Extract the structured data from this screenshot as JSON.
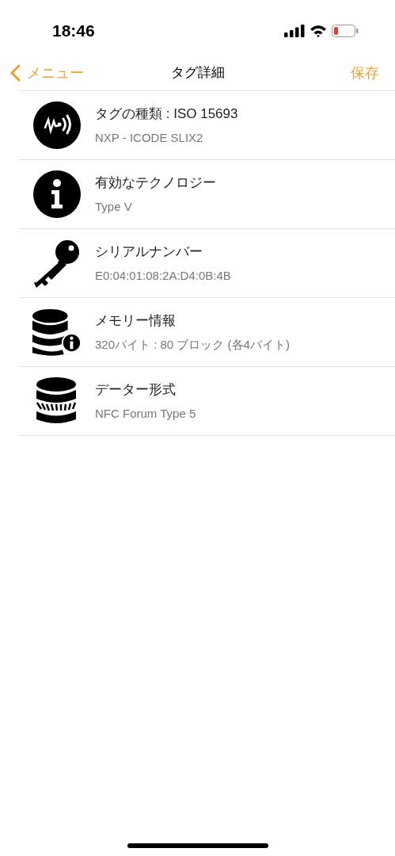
{
  "status_bar": {
    "time": "18:46"
  },
  "nav": {
    "back": "メニュー",
    "title": "タグ詳細",
    "action": "保存"
  },
  "rows": [
    {
      "kind": "nfc",
      "title": "タグの種類 : ISO 15693",
      "subtitle": "NXP - ICODE SLIX2"
    },
    {
      "kind": "info",
      "title": "有効なテクノロジー",
      "subtitle": "Type V"
    },
    {
      "kind": "key",
      "title": "シリアルナンバー",
      "subtitle": "E0:04:01:08:2A:D4:0B:4B"
    },
    {
      "kind": "memory",
      "title": "メモリー情報",
      "subtitle": "320バイト : 80 ブロック (各4バイト)"
    },
    {
      "kind": "format",
      "title": "データー形式",
      "subtitle": "NFC Forum Type 5"
    }
  ]
}
